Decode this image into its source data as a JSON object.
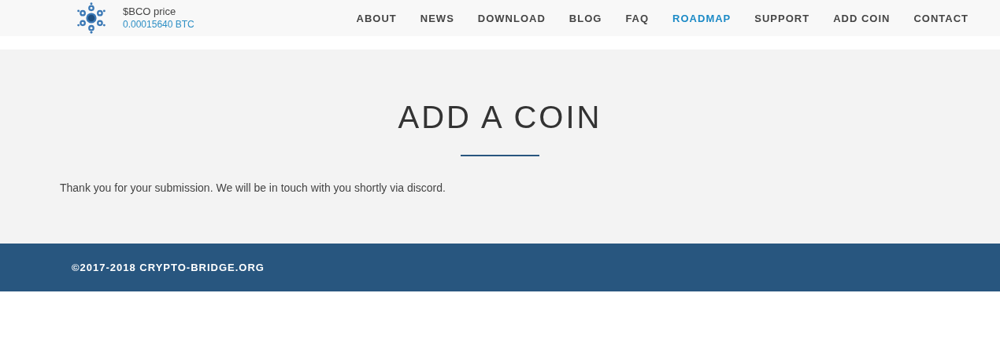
{
  "header": {
    "price_label": "$BCO price",
    "price_value": "0.00015640 BTC"
  },
  "nav": [
    {
      "label": "ABOUT",
      "selected": false
    },
    {
      "label": "NEWS",
      "selected": false
    },
    {
      "label": "DOWNLOAD",
      "selected": false
    },
    {
      "label": "BLOG",
      "selected": false
    },
    {
      "label": "FAQ",
      "selected": false
    },
    {
      "label": "ROADMAP",
      "selected": true
    },
    {
      "label": "SUPPORT",
      "selected": false
    },
    {
      "label": "ADD COIN",
      "selected": false
    },
    {
      "label": "CONTACT",
      "selected": false
    }
  ],
  "main": {
    "title": "ADD A COIN",
    "message": "Thank you for your submission. We will be in touch with you shortly via discord."
  },
  "footer": {
    "copyright": "©2017-2018 CRYPTO-BRIDGE.ORG"
  }
}
